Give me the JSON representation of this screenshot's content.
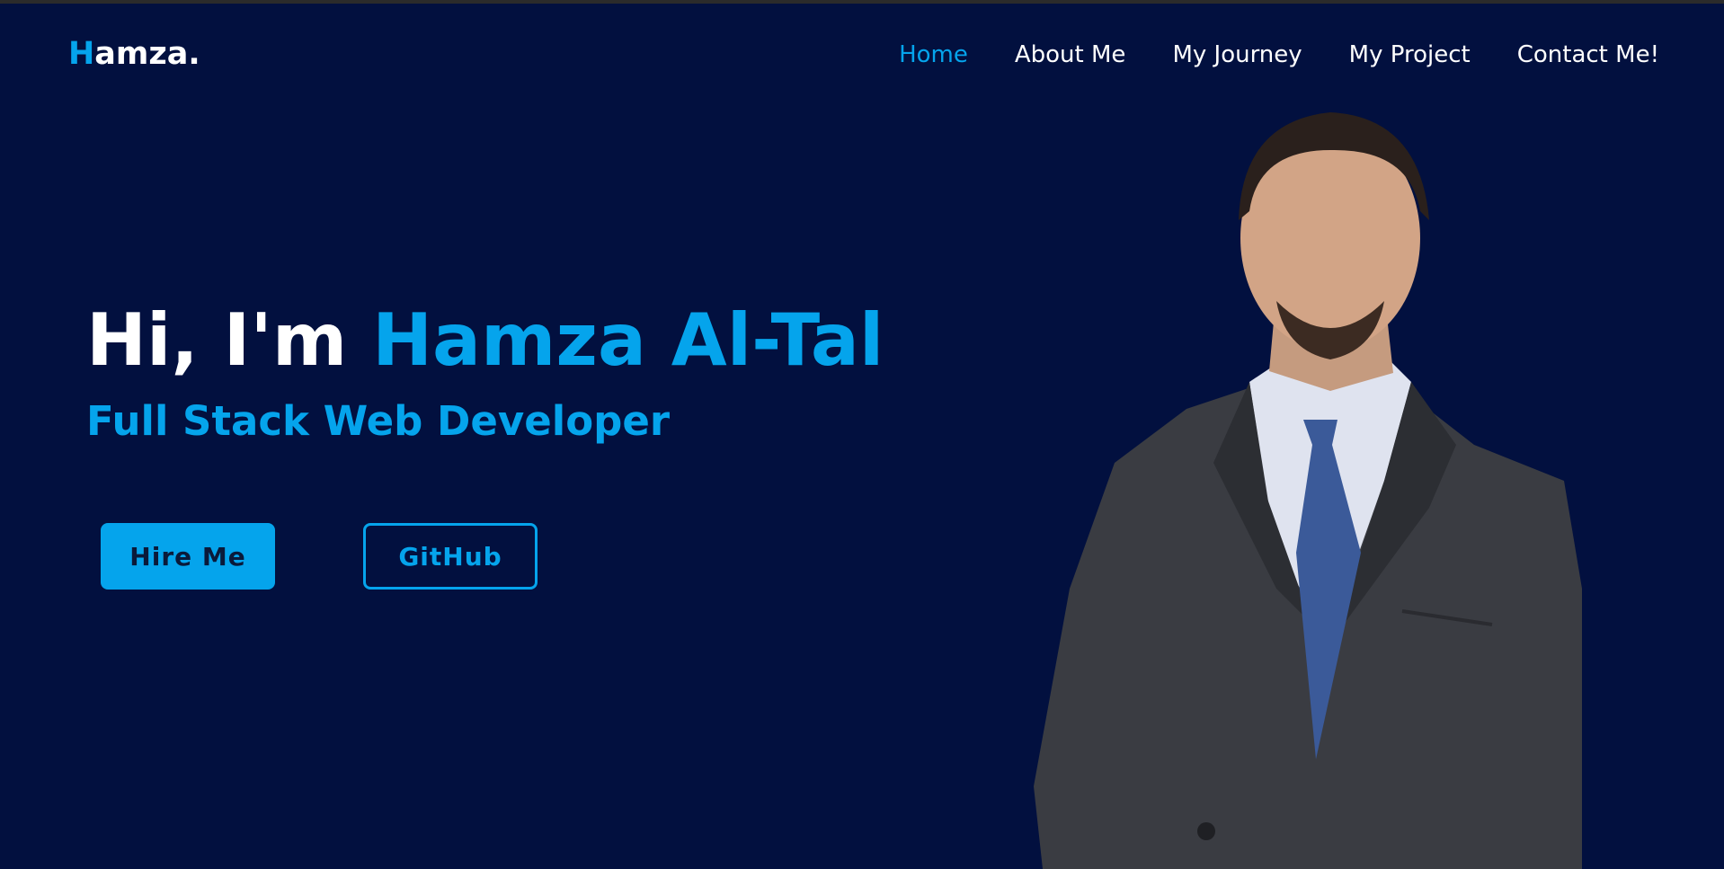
{
  "logo": {
    "first_letter": "H",
    "rest": "amza."
  },
  "nav": {
    "items": [
      {
        "label": "Home",
        "active": true
      },
      {
        "label": "About Me",
        "active": false
      },
      {
        "label": "My Journey",
        "active": false
      },
      {
        "label": "My Project",
        "active": false
      },
      {
        "label": "Contact Me!",
        "active": false
      }
    ]
  },
  "hero": {
    "greeting": "Hi, I'm",
    "name": "Hamza Al-Tal",
    "subtitle": "Full Stack Web Developer"
  },
  "buttons": {
    "hire_label": "Hire Me",
    "github_label": "GitHub"
  },
  "colors": {
    "background": "#02103f",
    "accent": "#05a4ec",
    "text": "#ffffff"
  }
}
